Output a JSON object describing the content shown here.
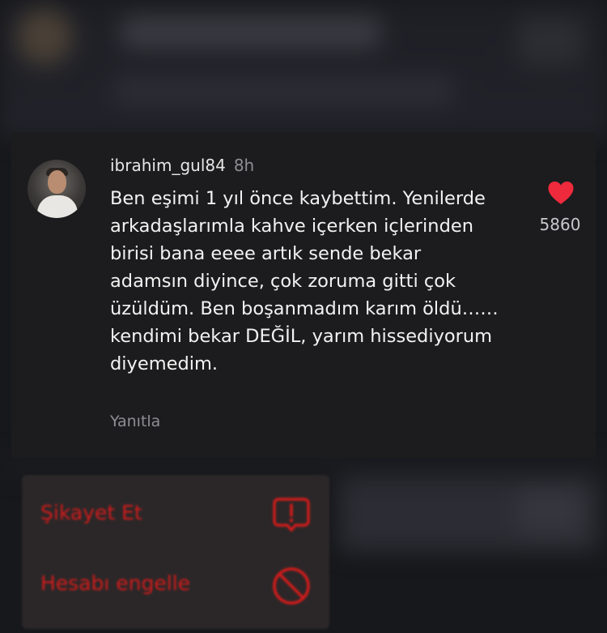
{
  "comment": {
    "username": "ibrahim_gul84",
    "time_ago": "8h",
    "text": "Ben eşimi 1 yıl önce kaybettim. Yenilerde arkadaşlarımla kahve içerken içlerinden birisi bana eeee artık sende bekar adamsın diyince, çok zoruma gitti çok üzüldüm. Ben boşanmadım karım öldü……kendimi bekar DEĞİL, yarım hissediyorum diyemedim.",
    "reply_label": "Yanıtla",
    "like_count": "5860",
    "like_icon": "heart-icon",
    "like_color": "#ee2a3c"
  },
  "menu": {
    "items": [
      {
        "label": "Şikayet Et",
        "icon": "report-icon"
      },
      {
        "label": "Hesabı engelle",
        "icon": "block-icon"
      }
    ],
    "accent_color": "#d21b1b"
  }
}
